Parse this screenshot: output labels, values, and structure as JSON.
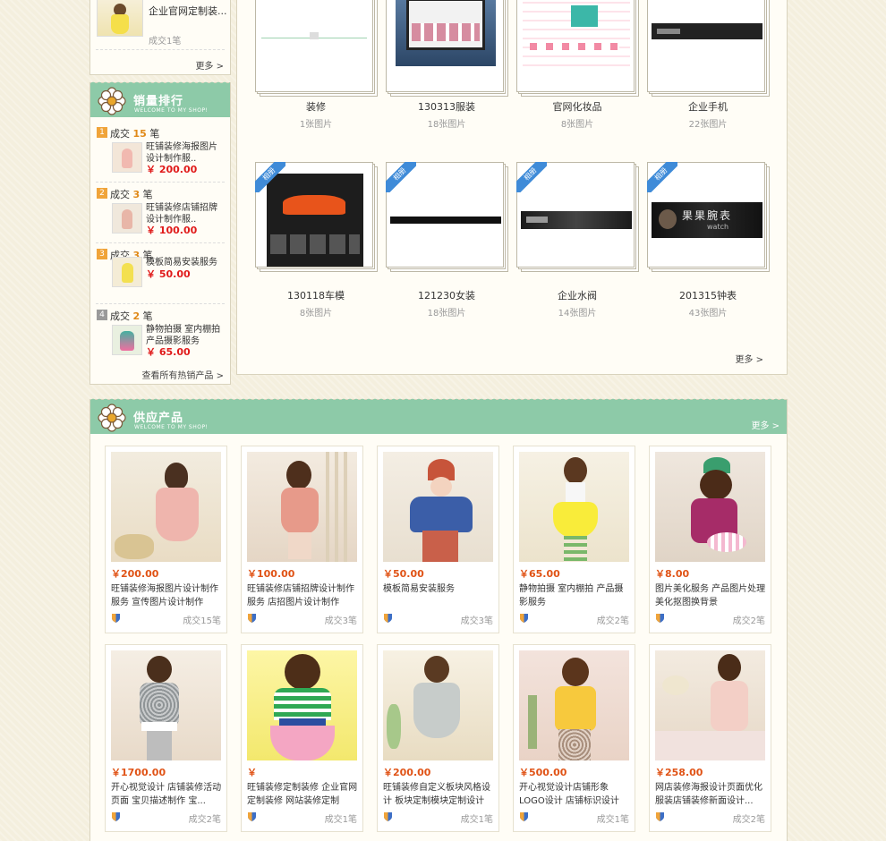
{
  "top_left_item": {
    "desc": "企业官网定制装...",
    "sold": "成交1笔"
  },
  "left_more": "更多 >",
  "ranking": {
    "title": "销量排行",
    "subtitle": "WELCOME TO MY SHOP!",
    "items": [
      {
        "rank": "1",
        "prefix": "成交",
        "count": "15",
        "suffix": "笔",
        "desc1": "旺铺装修海报图片",
        "desc2": "设计制作服..",
        "price": "￥ 200.00"
      },
      {
        "rank": "2",
        "prefix": "成交",
        "count": "3",
        "suffix": "笔",
        "desc1": "旺铺装修店铺招牌",
        "desc2": "设计制作服..",
        "price": "￥ 100.00"
      },
      {
        "rank": "3",
        "prefix": "成交",
        "count": "3",
        "suffix": "笔",
        "desc1": "模板简易安装服务",
        "desc2": "",
        "price": "￥ 50.00"
      },
      {
        "rank": "4",
        "prefix": "成交",
        "count": "2",
        "suffix": "笔",
        "desc1": "静物拍摄 室内棚拍",
        "desc2": "产品摄影服务",
        "price": "￥ 65.00"
      }
    ],
    "view_all": "查看所有热销产品 >"
  },
  "albums": {
    "ribbon": "相册",
    "row1": [
      {
        "name": "装修",
        "count": "1张图片"
      },
      {
        "name": "130313服装",
        "count": "18张图片"
      },
      {
        "name": "官网化妆品",
        "count": "8张图片"
      },
      {
        "name": "企业手机",
        "count": "22张图片"
      }
    ],
    "row2": [
      {
        "name": "130118车模",
        "count": "8张图片"
      },
      {
        "name": "121230女装",
        "count": "18张图片"
      },
      {
        "name": "企业水阀",
        "count": "14张图片"
      },
      {
        "name": "201315钟表",
        "count": "43张图片"
      }
    ],
    "watch_brand": "果果腕表",
    "watch_sub": "watch",
    "more": "更多 >"
  },
  "supply": {
    "title": "供应产品",
    "subtitle": "WELCOME TO MY SHOP!",
    "more": "更多 >",
    "row1": [
      {
        "price": "￥200.00",
        "desc": "旺铺装修海报图片设计制作服务 宣传图片设计制作",
        "sold": "成交15笔"
      },
      {
        "price": "￥100.00",
        "desc": "旺铺装修店铺招牌设计制作服务 店招图片设计制作",
        "sold": "成交3笔"
      },
      {
        "price": "￥50.00",
        "desc": "模板简易安装服务",
        "sold": "成交3笔"
      },
      {
        "price": "￥65.00",
        "desc": "静物拍摄 室内棚拍 产品摄影服务",
        "sold": "成交2笔"
      },
      {
        "price": "￥8.00",
        "desc": "图片美化服务 产品图片处理美化抠图换背景",
        "sold": "成交2笔"
      }
    ],
    "row2": [
      {
        "price": "￥1700.00",
        "desc": "开心视觉设计 店铺装修活动页面 宝贝描述制作 宝...",
        "sold": "成交2笔"
      },
      {
        "price": "￥",
        "desc": "旺铺装修定制装修 企业官网定制装修 网站装修定制",
        "sold": "成交1笔"
      },
      {
        "price": "￥200.00",
        "desc": "旺铺装修自定义板块风格设计 板块定制模块定制设计",
        "sold": "成交1笔"
      },
      {
        "price": "￥500.00",
        "desc": "开心视觉设计店铺形象LOGO设计 店铺标识设计",
        "sold": "成交1笔"
      },
      {
        "price": "￥258.00",
        "desc": "网店装修海报设计页面优化服装店铺装修新面设计...",
        "sold": "成交2笔"
      }
    ]
  }
}
